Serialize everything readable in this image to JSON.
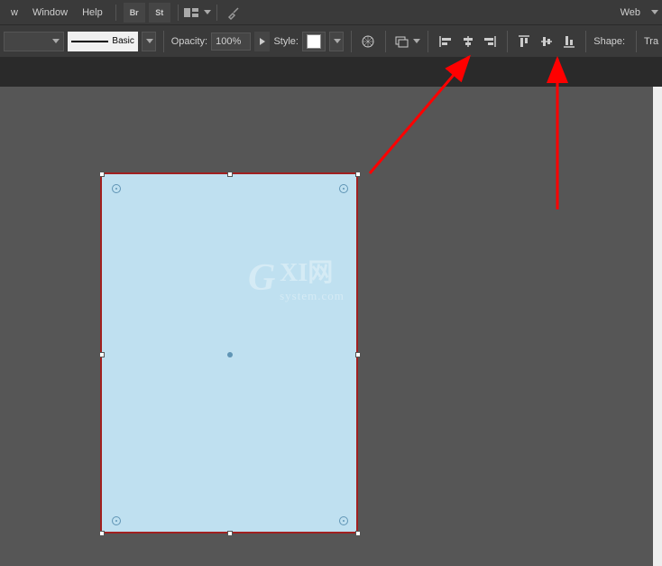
{
  "menubar": {
    "items": [
      "w",
      "Window",
      "Help"
    ],
    "bridge_label": "Br",
    "stock_label": "St",
    "web_label": "Web"
  },
  "toolbar": {
    "stroke_style": "Basic",
    "opacity_label": "Opacity:",
    "opacity_value": "100%",
    "style_label": "Style:",
    "shape_label": "Shape:",
    "transform_label": "Tra"
  },
  "watermark": {
    "g": "G",
    "xi": "XI网",
    "sub": "system.com"
  },
  "shape": {
    "fill": "#bfe0f0",
    "selection_border": "#a02020"
  },
  "annotations": {
    "arrow_color": "#ff0000"
  }
}
